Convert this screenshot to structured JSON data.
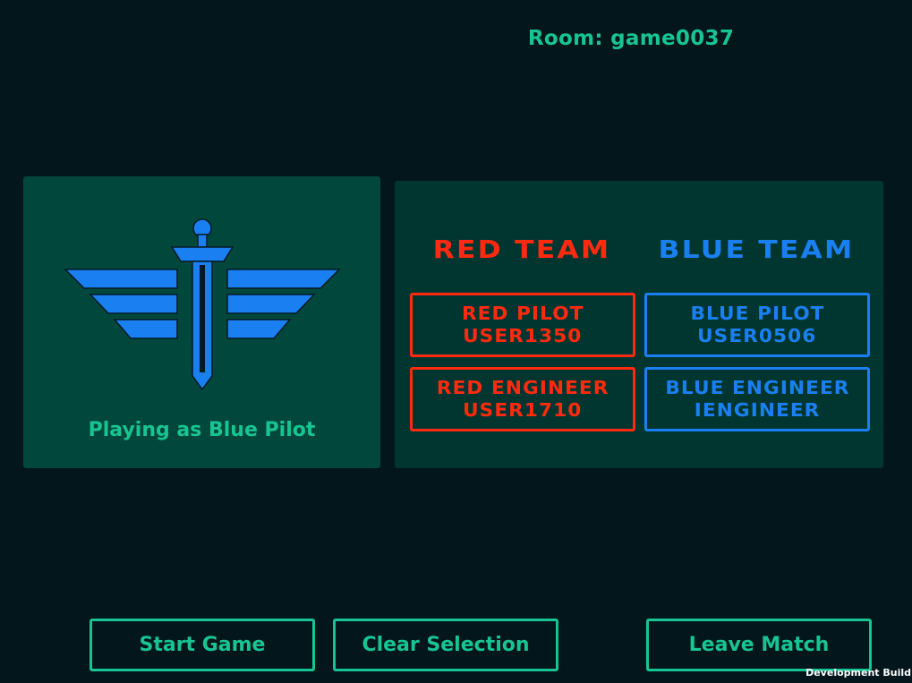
{
  "room": {
    "label": "Room:",
    "name": "game0037"
  },
  "role_panel": {
    "emblem_icon": "winged-sword-icon",
    "playing_as": "Playing as Blue Pilot"
  },
  "teams": {
    "red": {
      "title": "RED TEAM",
      "color": "#ff2a0f",
      "slots": [
        {
          "role": "RED PILOT",
          "user": "USER1350"
        },
        {
          "role": "RED ENGINEER",
          "user": "USER1710"
        }
      ]
    },
    "blue": {
      "title": "BLUE TEAM",
      "color": "#1a7ff0",
      "slots": [
        {
          "role": "BLUE PILOT",
          "user": "USER0506"
        },
        {
          "role": "BLUE ENGINEER",
          "user": "IENGINEER"
        }
      ]
    }
  },
  "buttons": {
    "start": "Start Game",
    "clear": "Clear Selection",
    "leave": "Leave Match"
  },
  "footer": {
    "build": "Development Build"
  },
  "colors": {
    "background": "#02161c",
    "accent": "#17c492",
    "panel": "#01473c",
    "team_panel": "#013630"
  }
}
